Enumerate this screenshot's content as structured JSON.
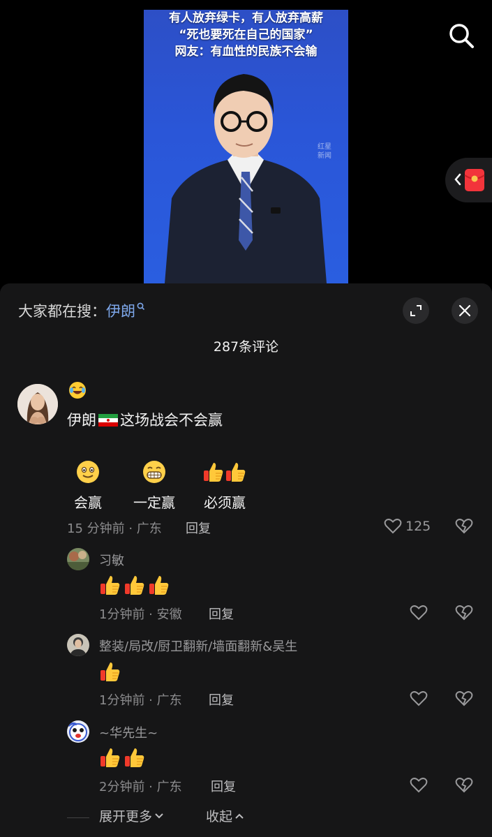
{
  "video": {
    "caption_lines": [
      "有人放弃绿卡，有人放弃高薪",
      "“死也要死在自己的国家”",
      "网友：有血性的民族不会输"
    ],
    "watermark_line1": "红星",
    "watermark_line2": "新闻"
  },
  "sheet": {
    "hot_search_prefix": "大家都在搜：",
    "hot_search_keyword": "伊朗",
    "comment_count": "287条评论"
  },
  "main_comment": {
    "text_before_flag": "伊朗",
    "text_after_flag": "这场战会不会赢",
    "poll_options": [
      {
        "label": "会赢",
        "icon": "smiling-emoji-icon"
      },
      {
        "label": "一定赢",
        "icon": "grinning-emoji-icon"
      },
      {
        "label": "必须赢",
        "icon": "thumbs-up-icon"
      }
    ],
    "meta": "15 分钟前 · 广东",
    "reply_label": "回复",
    "likes": "125"
  },
  "replies": [
    {
      "name": "习敏",
      "thumbs": 3,
      "meta": "1分钟前 · 安徽",
      "reply_label": "回复"
    },
    {
      "name": "整装/局改/厨卫翻新/墙面翻新&吴生",
      "thumbs": 1,
      "meta": "1分钟前 · 广东",
      "reply_label": "回复"
    },
    {
      "name": "~华先生~",
      "thumbs": 2,
      "meta": "2分钟前 · 广东",
      "reply_label": "回复"
    }
  ],
  "footer": {
    "expand_more": "展开更多",
    "collapse": "收起"
  },
  "colors": {
    "sheet_bg": "#161617",
    "keyword_blue": "#7da7ea",
    "video_blue": "#2a56d8"
  }
}
